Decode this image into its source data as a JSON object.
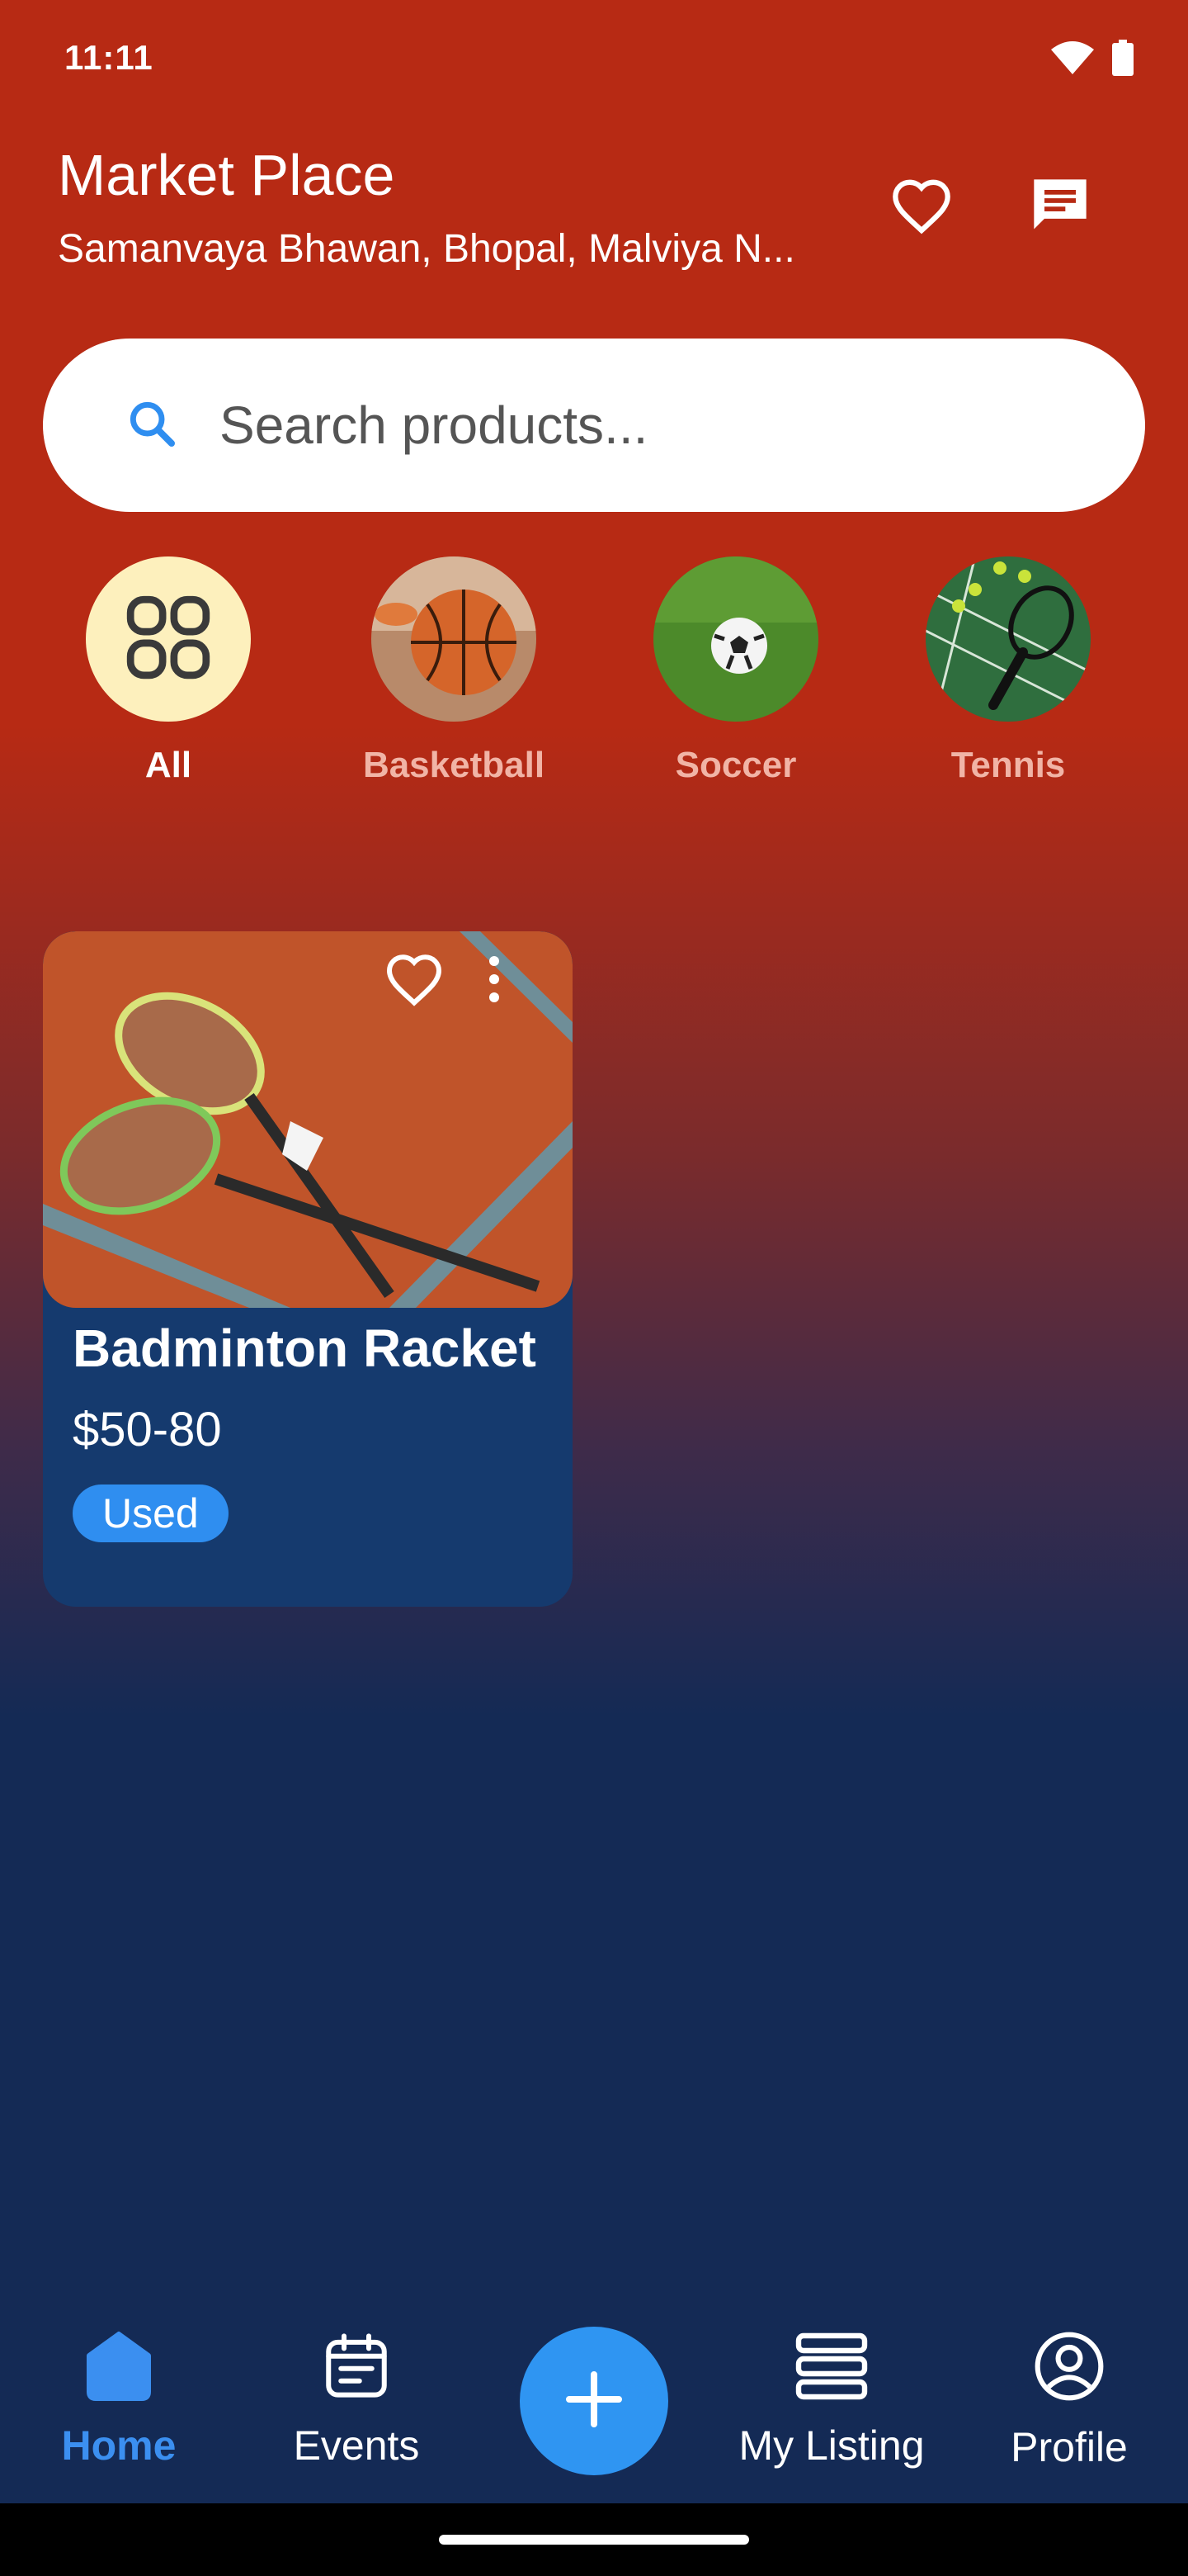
{
  "status_bar": {
    "time": "11:11"
  },
  "header": {
    "title": "Market Place",
    "subtitle": "Samanvaya Bhawan, Bhopal, Malviya N..."
  },
  "search": {
    "placeholder": "Search products..."
  },
  "categories": [
    {
      "label": "All",
      "icon": "grid-icon",
      "active": true
    },
    {
      "label": "Basketball",
      "icon": "basketball-image",
      "active": false
    },
    {
      "label": "Soccer",
      "icon": "soccer-image",
      "active": false
    },
    {
      "label": "Tennis",
      "icon": "tennis-image",
      "active": false
    }
  ],
  "listing": {
    "title": "Badminton Racket",
    "price": "$50-80",
    "condition": "Used"
  },
  "nav": {
    "home": "Home",
    "events": "Events",
    "my_listing": "My Listing",
    "profile": "Profile",
    "active": "home"
  },
  "colors": {
    "accent": "#2f8ef0",
    "header_bg": "#b72a14",
    "page_bottom_bg": "#142a55",
    "card_bg": "#153a6e",
    "all_category_bg": "#fdf0bd"
  }
}
